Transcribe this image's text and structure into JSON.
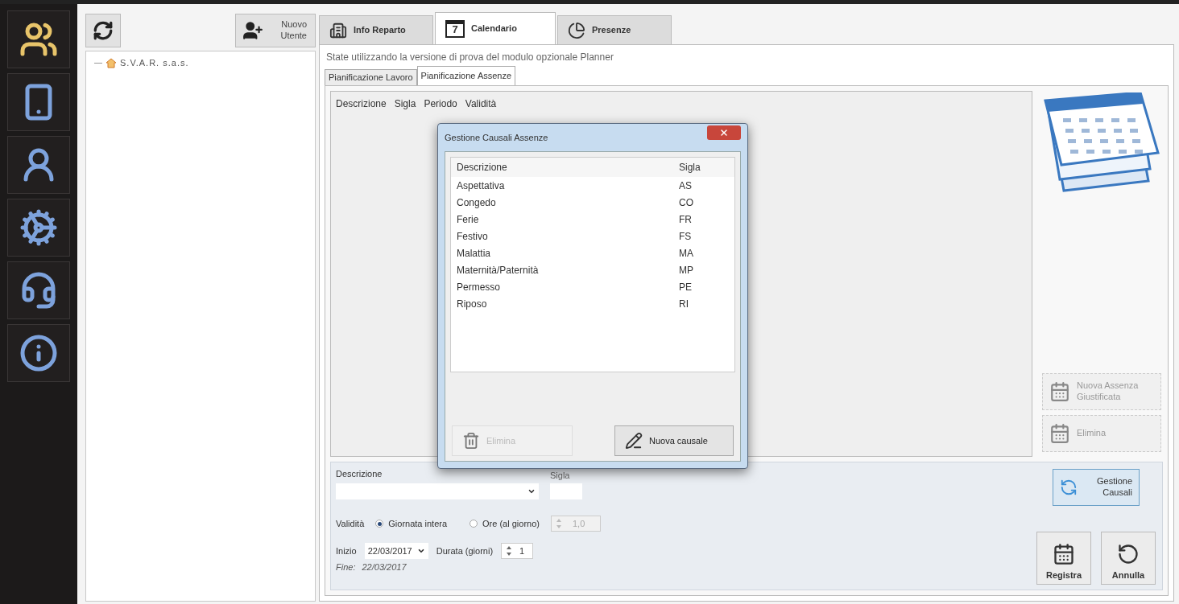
{
  "sidebar": {
    "items": [
      {
        "selected": true
      },
      {
        "selected": false
      },
      {
        "selected": false
      },
      {
        "selected": false
      },
      {
        "selected": false
      },
      {
        "selected": false
      }
    ]
  },
  "left_panel": {
    "new_user_button": {
      "label": "Nuovo Utente"
    },
    "tree": [
      {
        "label": "S.V.A.R. s.a.s."
      }
    ]
  },
  "tabs": [
    {
      "label": "Info Reparto",
      "selected": false
    },
    {
      "label": "Calendario",
      "selected": true,
      "icon_digit": "7"
    },
    {
      "label": "Presenze",
      "selected": false
    }
  ],
  "notice": "State utilizzando la versione di prova del modulo opzionale Planner",
  "sub_tabs": [
    {
      "label": "Pianificazione Lavoro",
      "selected": false
    },
    {
      "label": "Pianificazione Assenze",
      "selected": true
    }
  ],
  "absence_table": {
    "columns": [
      "Descrizione",
      "Sigla",
      "Periodo",
      "Validità"
    ]
  },
  "side_buttons": [
    {
      "label": "Nuova Assenza Giustificata",
      "disabled": true
    },
    {
      "label": "Elimina",
      "disabled": true
    }
  ],
  "form": {
    "description_label": "Descrizione",
    "sigla_label": "Sigla",
    "validity_label": "Validità",
    "validity_options": [
      {
        "label": "Giornata intera",
        "selected": true
      },
      {
        "label": "Ore (al giorno)",
        "selected": false
      }
    ],
    "hours_value": "1,0",
    "start_label": "Inizio",
    "start_date": "22/03/2017",
    "duration_label": "Durata (giorni)",
    "duration_value": "1",
    "end_label": "Fine:",
    "end_date": "22/03/2017"
  },
  "gestione_button": {
    "label": "Gestione Causali"
  },
  "action_buttons": [
    {
      "label": "Registra",
      "kind": "save"
    },
    {
      "label": "Annulla",
      "kind": "undo"
    }
  ],
  "dialog": {
    "title": "Gestione Causali Assenze",
    "columns": [
      "Descrizione",
      "Sigla"
    ],
    "rows": [
      {
        "description": "Aspettativa",
        "code": "AS"
      },
      {
        "description": "Congedo",
        "code": "CO"
      },
      {
        "description": "Ferie",
        "code": "FR"
      },
      {
        "description": "Festivo",
        "code": "FS"
      },
      {
        "description": "Malattia",
        "code": "MA"
      },
      {
        "description": "Maternità/Paternità",
        "code": "MP"
      },
      {
        "description": "Permesso",
        "code": "PE"
      },
      {
        "description": "Riposo",
        "code": "RI"
      }
    ],
    "buttons": [
      {
        "label": "Elimina",
        "kind": "delete",
        "disabled": true
      },
      {
        "label": "Nuova causale",
        "kind": "new",
        "disabled": false
      }
    ]
  }
}
